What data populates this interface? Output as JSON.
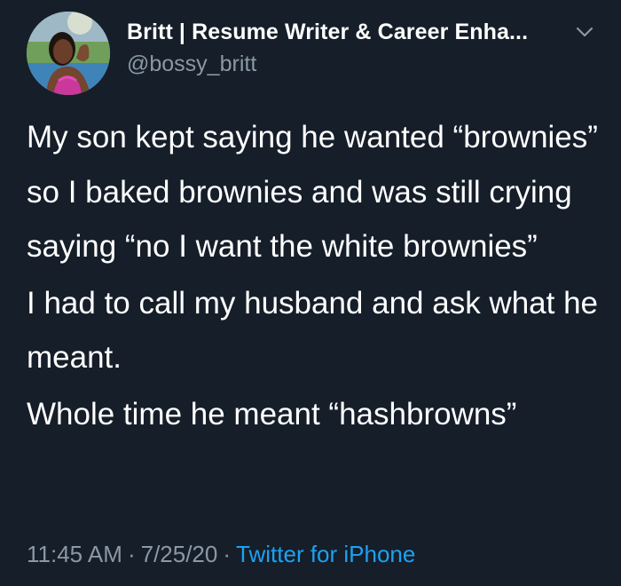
{
  "user": {
    "display_name": "Britt | Resume Writer & Career Enha...",
    "handle": "@bossy_britt"
  },
  "tweet": {
    "paragraphs": [
      "My son kept saying he wanted “brownies” so I baked brownies and was still crying saying “no I want the white brownies”",
      "I had to call my husband and ask what he meant.",
      "Whole time he meant “hashbrowns”"
    ],
    "time": "11:45 AM",
    "date": "7/25/20",
    "separator": "·",
    "source": "Twitter for iPhone"
  },
  "icons": {
    "menu": "chevron-down-icon",
    "avatar": "profile-photo"
  },
  "colors": {
    "background": "#151e29",
    "text_primary": "#ffffff",
    "text_secondary": "#8b98a5",
    "link": "#1da1f2"
  }
}
